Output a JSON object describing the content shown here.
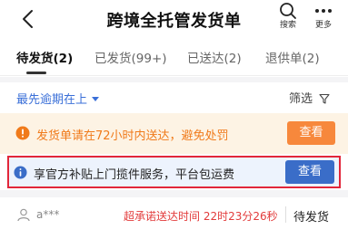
{
  "header": {
    "title": "跨境全托管发货单",
    "back_icon": "chevron-left-icon",
    "search_label": "搜索",
    "more_label": "更多"
  },
  "tabs": [
    {
      "label": "待发货(2)",
      "active": true
    },
    {
      "label": "已发货(99+)",
      "active": false
    },
    {
      "label": "已送达(2)",
      "active": false
    },
    {
      "label": "退供单(2)",
      "active": false
    }
  ],
  "sortbar": {
    "sort_label": "最先逾期在上",
    "filter_label": "筛选"
  },
  "notices": {
    "warning": {
      "text": "发货单请在72小时内送达，避免处罚",
      "button": "查看",
      "color": "#f07a1a"
    },
    "info": {
      "text": "享官方补贴上门揽件服务，平台包运费",
      "button": "查看",
      "color": "#3a6dc8"
    }
  },
  "order": {
    "buyer": "a***",
    "deadline": "超承诺送达时间 22时23分26秒",
    "status": "待发货"
  },
  "colors": {
    "accent_blue": "#3a6fd8",
    "warning_orange": "#f7883c",
    "alert_red": "#e23b3b",
    "highlight_border": "#e2263a"
  }
}
